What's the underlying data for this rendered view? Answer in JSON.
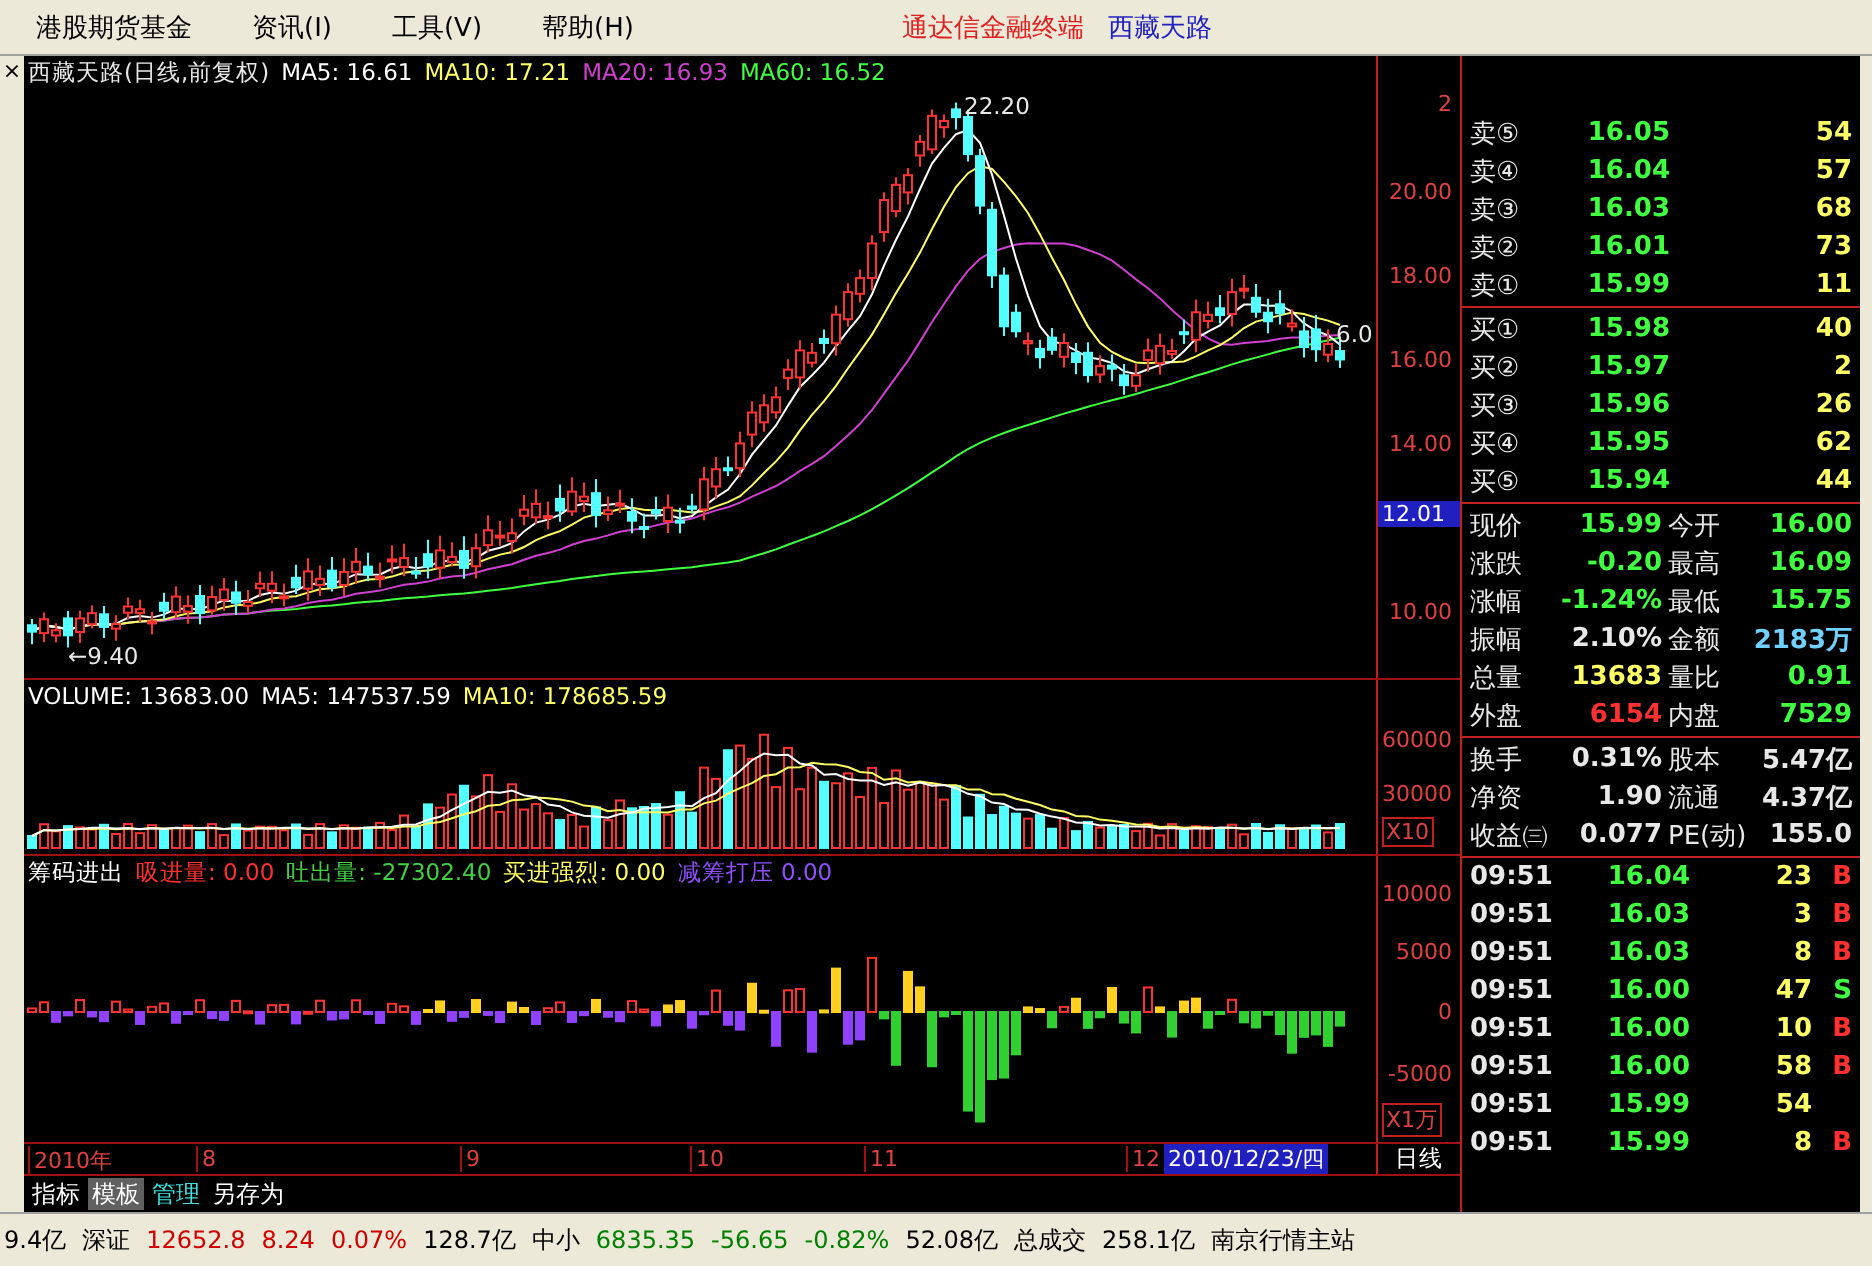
{
  "menu_bar": {
    "items": [
      "港股期货基金",
      "资讯(I)",
      "工具(V)",
      "帮助(H)"
    ],
    "app_title": "通达信金融终端",
    "stock_title": "西藏天路"
  },
  "left_strip": {
    "close": "×"
  },
  "price_pane": {
    "legend": [
      {
        "text": "西藏天路(日线,前复权)",
        "color": "#e8e8e8"
      },
      {
        "text": "MA5: 16.61",
        "color": "#ffffff"
      },
      {
        "text": "MA10: 17.21",
        "color": "#ffff66"
      },
      {
        "text": "MA20: 16.93",
        "color": "#d040d0"
      },
      {
        "text": "MA60: 16.52",
        "color": "#40ff40"
      }
    ],
    "peak_label": "22.20",
    "low_label": "←9.40",
    "last_label": "6.0",
    "axis_ticks": [
      "2",
      "20.00",
      "18.00",
      "16.00",
      "14.00",
      "10.00"
    ],
    "current_marker": "12.01"
  },
  "volume_pane": {
    "legend": [
      {
        "text": "VOLUME: 13683.00",
        "color": "#ffffff"
      },
      {
        "text": "MA5: 147537.59",
        "color": "#ffffff"
      },
      {
        "text": "MA10: 178685.59",
        "color": "#ffff66"
      }
    ],
    "axis_ticks": [
      "60000",
      "30000"
    ],
    "unit": "X10"
  },
  "indicator_pane": {
    "legend": [
      {
        "text": "筹码进出",
        "color": "#ffffff"
      },
      {
        "text": "吸进量: 0.00",
        "color": "#ff3030"
      },
      {
        "text": "吐出量: -27302.40",
        "color": "#40d040"
      },
      {
        "text": "买进强烈: 0.00",
        "color": "#ffff66"
      },
      {
        "text": "减筹打压 0.00",
        "color": "#9050ff"
      }
    ],
    "axis_ticks": [
      "10000",
      "5000",
      "0",
      "-5000"
    ],
    "unit": "X1万"
  },
  "date_axis": {
    "labels": [
      "2010年",
      "8",
      "9",
      "10",
      "11",
      "12"
    ],
    "cursor_date": "2010/12/23/四",
    "period": "日线"
  },
  "bottom_tabs": [
    {
      "label": "指标",
      "selected": false,
      "color": "#ffffff"
    },
    {
      "label": "模板",
      "selected": true,
      "color": "#ffffff"
    },
    {
      "label": "管理",
      "selected": false,
      "color": "#40e0e0"
    },
    {
      "label": "另存为",
      "selected": false,
      "color": "#ffffff"
    }
  ],
  "order_book": {
    "sell": [
      {
        "label": "卖⑤",
        "price": "16.05",
        "volume": "54"
      },
      {
        "label": "卖④",
        "price": "16.04",
        "volume": "57"
      },
      {
        "label": "卖③",
        "price": "16.03",
        "volume": "68"
      },
      {
        "label": "卖②",
        "price": "16.01",
        "volume": "73"
      },
      {
        "label": "卖①",
        "price": "15.99",
        "volume": "11"
      }
    ],
    "buy": [
      {
        "label": "买①",
        "price": "15.98",
        "volume": "40"
      },
      {
        "label": "买②",
        "price": "15.97",
        "volume": "2"
      },
      {
        "label": "买③",
        "price": "15.96",
        "volume": "26"
      },
      {
        "label": "买④",
        "price": "15.95",
        "volume": "62"
      },
      {
        "label": "买⑤",
        "price": "15.94",
        "volume": "44"
      }
    ]
  },
  "quote_stats": [
    {
      "label": "现价",
      "value": "15.99",
      "color": "#40ff40"
    },
    {
      "label": "今开",
      "value": "16.00",
      "color": "#40ff40"
    },
    {
      "label": "涨跌",
      "value": "-0.20",
      "color": "#40ff40"
    },
    {
      "label": "最高",
      "value": "16.09",
      "color": "#40ff40"
    },
    {
      "label": "涨幅",
      "value": "-1.24%",
      "color": "#40ff40"
    },
    {
      "label": "最低",
      "value": "15.75",
      "color": "#40ff40"
    },
    {
      "label": "振幅",
      "value": "2.10%",
      "color": "#e8e8e8"
    },
    {
      "label": "金额",
      "value": "2183万",
      "color": "#70d0ff"
    },
    {
      "label": "总量",
      "value": "13683",
      "color": "#ffff66"
    },
    {
      "label": "量比",
      "value": "0.91",
      "color": "#40ff40"
    },
    {
      "label": "外盘",
      "value": "6154",
      "color": "#ff3030"
    },
    {
      "label": "内盘",
      "value": "7529",
      "color": "#40ff40"
    }
  ],
  "finance_stats": [
    {
      "label": "换手",
      "value": "0.31%"
    },
    {
      "label": "股本",
      "value": "5.47亿"
    },
    {
      "label": "净资",
      "value": "1.90"
    },
    {
      "label": "流通",
      "value": "4.37亿"
    },
    {
      "label": "收益㈢",
      "value": "0.077"
    },
    {
      "label": "PE(动)",
      "value": "155.0"
    }
  ],
  "trades": [
    {
      "time": "09:51",
      "price": "16.04",
      "volume": "23",
      "side": "B",
      "color": "#ff3030"
    },
    {
      "time": "09:51",
      "price": "16.03",
      "volume": "3",
      "side": "B",
      "color": "#ff3030"
    },
    {
      "time": "09:51",
      "price": "16.03",
      "volume": "8",
      "side": "B",
      "color": "#ff3030"
    },
    {
      "time": "09:51",
      "price": "16.00",
      "volume": "47",
      "side": "S",
      "color": "#40ff40"
    },
    {
      "time": "09:51",
      "price": "16.00",
      "volume": "10",
      "side": "B",
      "color": "#ff3030"
    },
    {
      "time": "09:51",
      "price": "16.00",
      "volume": "58",
      "side": "B",
      "color": "#ff3030"
    },
    {
      "time": "09:51",
      "price": "15.99",
      "volume": "54"
    },
    {
      "time": "09:51",
      "price": "15.99",
      "volume": "8",
      "side": "B",
      "color": "#ff3030"
    }
  ],
  "status_bar": [
    {
      "text": "9.4亿",
      "color": "#000000"
    },
    {
      "text": "深证",
      "color": "#000000"
    },
    {
      "text": "12652.8",
      "color": "#d00000"
    },
    {
      "text": "8.24",
      "color": "#d00000"
    },
    {
      "text": "0.07%",
      "color": "#d00000"
    },
    {
      "text": "128.7亿",
      "color": "#000000"
    },
    {
      "text": "中小",
      "color": "#000000"
    },
    {
      "text": "6835.35",
      "color": "#008000"
    },
    {
      "text": "-56.65",
      "color": "#008000"
    },
    {
      "text": "-0.82%",
      "color": "#008000"
    },
    {
      "text": "52.08亿",
      "color": "#000000"
    },
    {
      "text": "总成交",
      "color": "#000000"
    },
    {
      "text": "258.1亿",
      "color": "#000000"
    },
    {
      "text": "南京行情主站",
      "color": "#000000"
    }
  ]
}
